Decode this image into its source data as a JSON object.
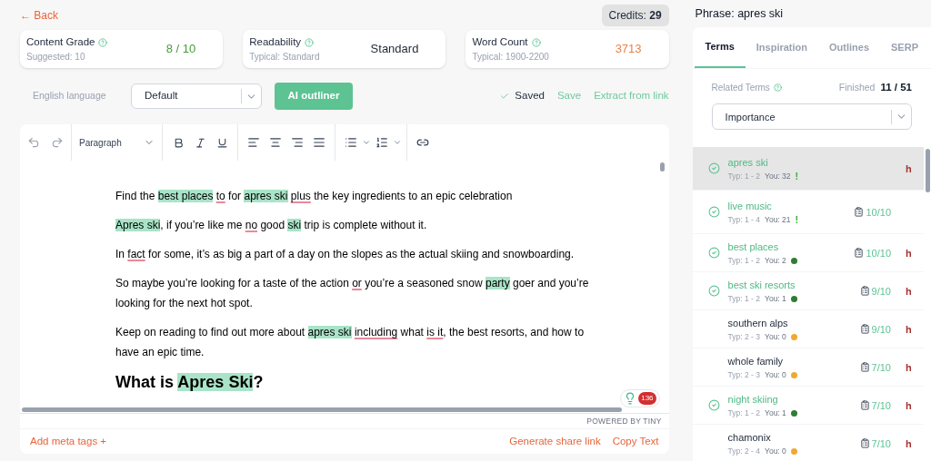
{
  "back": "← Back",
  "credits": {
    "label": "Credits:",
    "value": "29"
  },
  "stats": [
    {
      "title": "Content Grade",
      "sub": "Suggested: 10",
      "value": "8 / 10",
      "color": "#4a9a3c"
    },
    {
      "title": "Readability",
      "sub": "Typical: Standard",
      "value": "Standard",
      "color": "#1f2937"
    },
    {
      "title": "Word Count",
      "sub": "Typical: 1900-2200",
      "value": "3713",
      "color": "#e8824a"
    }
  ],
  "controls": {
    "language": "English language",
    "style": "Default",
    "outliner": "AI outliner",
    "saved": "Saved",
    "save": "Save",
    "extract": "Extract from link"
  },
  "toolbar": {
    "block": "Paragraph"
  },
  "paragraphs": [
    {
      "kind": "p",
      "segments": [
        {
          "text": "Find the",
          "kind": "plain"
        },
        {
          "text": "best places",
          "kind": "term",
          "space_before": true
        },
        {
          "text": "to",
          "kind": "spell",
          "space_before": true
        },
        {
          "text": "for",
          "kind": "plain",
          "space_before": true
        },
        {
          "text": "apres ski",
          "kind": "term",
          "space_before": true
        },
        {
          "text": "plus",
          "kind": "spell",
          "space_before": true
        },
        {
          "text": "the key ingredients to an epic celebration",
          "kind": "plain",
          "space_before": true
        }
      ]
    },
    {
      "kind": "p",
      "segments": [
        {
          "text": "Apres ski",
          "kind": "term"
        },
        {
          "text": ", if you’re like me",
          "kind": "plain"
        },
        {
          "text": "no",
          "kind": "spell",
          "space_before": true
        },
        {
          "text": "good",
          "kind": "plain",
          "space_before": true
        },
        {
          "text": "ski",
          "kind": "term",
          "space_before": true
        },
        {
          "text": "trip is complete without it.",
          "kind": "plain",
          "space_before": true
        }
      ]
    },
    {
      "kind": "p",
      "segments": [
        {
          "text": "In",
          "kind": "plain"
        },
        {
          "text": "fact",
          "kind": "spell",
          "space_before": true
        },
        {
          "text": "for some, it’s as big a part of a day on the slopes as the actual skiing and snowboarding.",
          "kind": "plain",
          "space_before": true
        }
      ]
    },
    {
      "kind": "p",
      "segments": [
        {
          "text": "So maybe you’re looking for a taste of the action",
          "kind": "plain"
        },
        {
          "text": "or",
          "kind": "spell",
          "space_before": true
        },
        {
          "text": "you’re a seasoned snow",
          "kind": "plain",
          "space_before": true
        },
        {
          "text": "party",
          "kind": "term",
          "space_before": true
        },
        {
          "text": "goer and you’re looking for the next hot spot.",
          "kind": "plain",
          "space_before": true
        }
      ]
    },
    {
      "kind": "p",
      "segments": [
        {
          "text": "Keep on reading to find out more about",
          "kind": "plain"
        },
        {
          "text": "apres ski",
          "kind": "term",
          "space_before": true
        },
        {
          "text": "including",
          "kind": "spell",
          "space_before": true
        },
        {
          "text": "what",
          "kind": "plain",
          "space_before": true
        },
        {
          "text": "is it",
          "kind": "spell",
          "space_before": true
        },
        {
          "text": ", the best resorts, and how to have an epic time.",
          "kind": "plain"
        }
      ]
    },
    {
      "kind": "h2",
      "segments": [
        {
          "text": "What is",
          "kind": "plain"
        },
        {
          "text": "Apres Ski",
          "kind": "term",
          "space_before": true
        },
        {
          "text": "?",
          "kind": "plain"
        }
      ]
    }
  ],
  "badge": "136",
  "powered": "POWERED BY TINY",
  "footer": {
    "meta": "Add meta tags +",
    "share": "Generate share link",
    "copy": "Copy Text"
  },
  "phrase": "Phrase: apres ski",
  "tabs": [
    {
      "label": "Terms",
      "selected": true
    },
    {
      "label": "Inspiration",
      "selected": false
    },
    {
      "label": "Outlines",
      "selected": false
    },
    {
      "label": "SERP",
      "selected": false
    }
  ],
  "related": {
    "label": "Related Terms",
    "finished_label": "Finished",
    "finished": "11 / 51",
    "sort": "Importance"
  },
  "terms": [
    {
      "name": "apres ski",
      "typ": "Typ: 1 - 2",
      "you": "You: 32",
      "flag": "!",
      "done": true,
      "selected": true,
      "priority": "h"
    },
    {
      "name": "live music",
      "typ": "Typ: 1 - 4",
      "you": "You: 21",
      "flag": "!",
      "done": true,
      "selected": false,
      "score": "10/10"
    },
    {
      "name": "best places",
      "typ": "Typ: 1 - 2",
      "you": "You: 2",
      "color": "#2e7d32",
      "done": true,
      "selected": false,
      "score": "10/10",
      "priority": "h"
    },
    {
      "name": "best ski resorts",
      "typ": "Typ: 1 - 2",
      "you": "You: 1",
      "color": "#2e7d32",
      "done": true,
      "selected": false,
      "score": "9/10",
      "priority": "h"
    },
    {
      "name": "southern alps",
      "typ": "Typ: 2 - 3",
      "you": "You: 0",
      "color": "#f0a830",
      "done": false,
      "selected": false,
      "score": "9/10",
      "priority": "h"
    },
    {
      "name": "whole family",
      "typ": "Typ: 2 - 3",
      "you": "You: 0",
      "color": "#f0a830",
      "done": false,
      "selected": false,
      "score": "7/10",
      "priority": "h"
    },
    {
      "name": "night skiing",
      "typ": "Typ: 1 - 2",
      "you": "You: 1",
      "color": "#2e7d32",
      "done": true,
      "selected": false,
      "score": "7/10",
      "priority": "h"
    },
    {
      "name": "chamonix",
      "typ": "Typ: 2 - 4",
      "you": "You: 0",
      "color": "#f0a830",
      "done": false,
      "selected": false,
      "score": "7/10",
      "priority": "h"
    }
  ]
}
